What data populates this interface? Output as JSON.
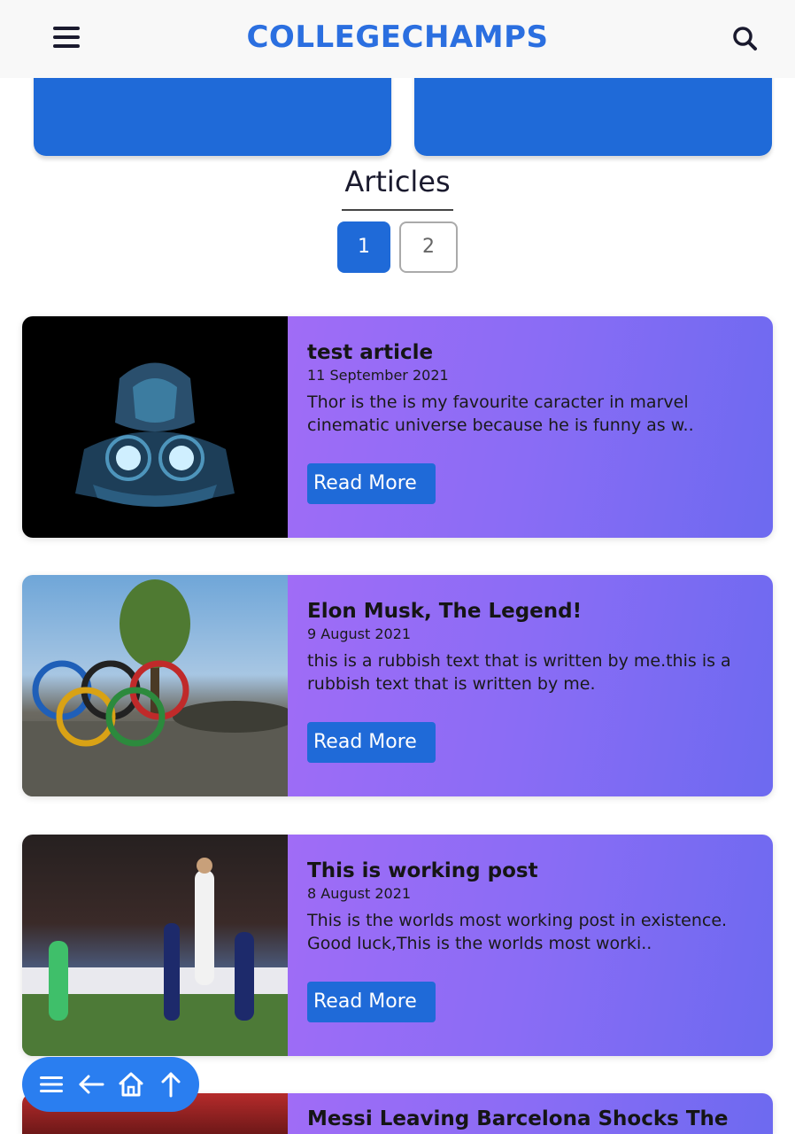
{
  "header": {
    "brand": "COLLEGECHAMPS",
    "menu_icon": "hamburger-menu-icon",
    "search_icon": "search-icon"
  },
  "section": {
    "title": "Articles"
  },
  "pagination": {
    "pages": [
      "1",
      "2"
    ],
    "current": "1"
  },
  "articles": [
    {
      "title": "test article",
      "date": "11 September 2021",
      "excerpt": "Thor is the is my favourite caracter in marvel cinematic universe because he is funny as w..",
      "button": "Read More",
      "thumb": "thor-illustration"
    },
    {
      "title": "Elon Musk, The Legend!",
      "date": "9 August 2021",
      "excerpt": "this is a rubbish text that is written by me.this is a rubbish text that is written by me.",
      "button": "Read More",
      "thumb": "olympic-rings-photo"
    },
    {
      "title": "This is working post",
      "date": "8 August 2021",
      "excerpt": "This is the worlds most working post in existence. Good luck,This is the worlds most worki..",
      "button": "Read More",
      "thumb": "football-match-photo"
    },
    {
      "title": "Messi Leaving Barcelona Shocks The",
      "thumb": "stadium-photo"
    }
  ],
  "float_nav": {
    "icons": [
      "menu-icon",
      "back-arrow-icon",
      "home-icon",
      "scroll-top-icon"
    ]
  },
  "colors": {
    "brand": "#2b6fe0",
    "primary_button": "#1f6ad8",
    "card_gradient_start": "#a06cf6",
    "card_gradient_end": "#6d6af0",
    "float_nav": "#2a7ef0"
  }
}
